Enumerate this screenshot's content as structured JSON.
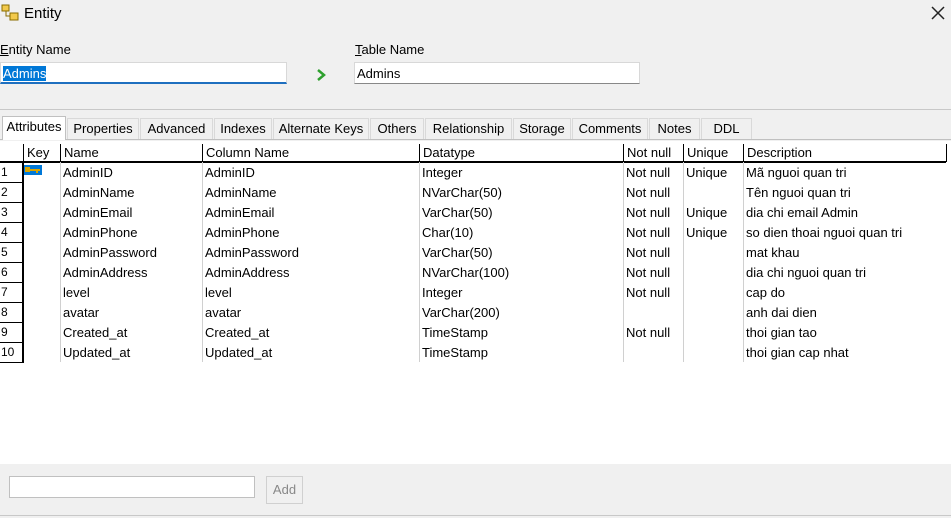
{
  "window": {
    "title": "Entity",
    "app_icon": "entity-icon",
    "close_icon": "close-icon"
  },
  "form": {
    "entity_name_label_first": "E",
    "entity_name_label_rest": "ntity Name",
    "entity_name_value": "Admins",
    "table_name_label_first": "T",
    "table_name_label_rest": "able Name",
    "table_name_value": "Admins",
    "sync_icon": "arrow-right-icon"
  },
  "tabs": [
    {
      "label": "Attributes",
      "active": true
    },
    {
      "label": "Properties"
    },
    {
      "label": "Advanced"
    },
    {
      "label": "Indexes"
    },
    {
      "label": "Alternate Keys"
    },
    {
      "label": "Others"
    },
    {
      "label": "Relationship"
    },
    {
      "label": "Storage"
    },
    {
      "label": "Comments"
    },
    {
      "label": "Notes"
    },
    {
      "label": "DDL"
    }
  ],
  "grid": {
    "headers": {
      "key": "Key",
      "name": "Name",
      "column_name": "Column Name",
      "datatype": "Datatype",
      "not_null": "Not null",
      "unique": "Unique",
      "description": "Description"
    },
    "rows": [
      {
        "num": "1",
        "pk": true,
        "name": "AdminID",
        "column": "AdminID",
        "datatype": "Integer",
        "not_null": "Not null",
        "unique": "Unique",
        "description": "Mã nguoi quan tri"
      },
      {
        "num": "2",
        "pk": false,
        "name": "AdminName",
        "column": "AdminName",
        "datatype": "NVarChar(50)",
        "not_null": "Not null",
        "unique": "",
        "description": "Tên nguoi quan tri"
      },
      {
        "num": "3",
        "pk": false,
        "name": "AdminEmail",
        "column": "AdminEmail",
        "datatype": "VarChar(50)",
        "not_null": "Not null",
        "unique": "Unique",
        "description": "dia chi email Admin"
      },
      {
        "num": "4",
        "pk": false,
        "name": "AdminPhone",
        "column": "AdminPhone",
        "datatype": "Char(10)",
        "not_null": "Not null",
        "unique": "Unique",
        "description": "so dien thoai nguoi quan tri"
      },
      {
        "num": "5",
        "pk": false,
        "name": "AdminPassword",
        "column": "AdminPassword",
        "datatype": "VarChar(50)",
        "not_null": "Not null",
        "unique": "",
        "description": "mat khau"
      },
      {
        "num": "6",
        "pk": false,
        "name": "AdminAddress",
        "column": "AdminAddress",
        "datatype": "NVarChar(100)",
        "not_null": "Not null",
        "unique": "",
        "description": "dia chi nguoi quan tri"
      },
      {
        "num": "7",
        "pk": false,
        "name": "level",
        "column": "level",
        "datatype": "Integer",
        "not_null": "Not null",
        "unique": "",
        "description": "cap do"
      },
      {
        "num": "8",
        "pk": false,
        "name": "avatar",
        "column": "avatar",
        "datatype": "VarChar(200)",
        "not_null": "",
        "unique": "",
        "description": "anh dai dien"
      },
      {
        "num": "9",
        "pk": false,
        "name": "Created_at",
        "column": "Created_at",
        "datatype": "TimeStamp",
        "not_null": "Not null",
        "unique": "",
        "description": "thoi gian tao"
      },
      {
        "num": "10",
        "pk": false,
        "name": "Updated_at",
        "column": "Updated_at",
        "datatype": "TimeStamp",
        "not_null": "",
        "unique": "",
        "description": "thoi gian cap nhat"
      }
    ]
  },
  "footer": {
    "add_label": "Add"
  },
  "colors": {
    "selection": "#0078d7",
    "key_icon": "#d9a400",
    "sync_arrow": "#2ea02e"
  }
}
